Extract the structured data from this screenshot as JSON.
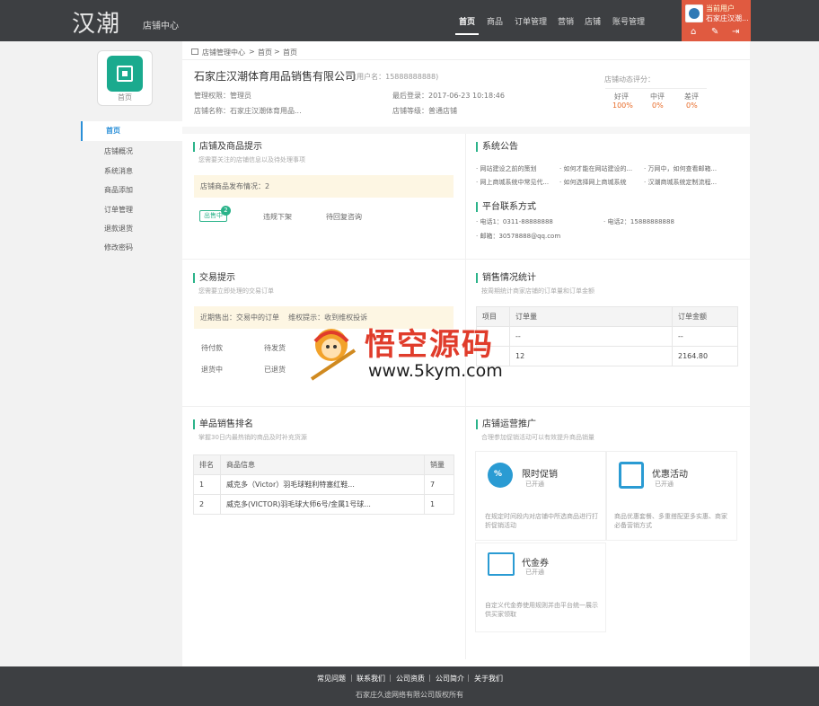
{
  "header": {
    "logo": "汉潮",
    "subtitle": "店铺中心",
    "nav": [
      "首页",
      "商品",
      "订单管理",
      "营销",
      "店铺",
      "账号管理"
    ],
    "user_label": "当前用户",
    "user_name": "石家庄汉潮..."
  },
  "sidebar": {
    "shop_label": "首页",
    "items": [
      "首页",
      "店铺概况",
      "系统消息",
      "商品添加",
      "订单管理",
      "退款退货",
      "修改密码"
    ]
  },
  "breadcrumb": [
    "店铺管理中心",
    ">",
    "首页",
    ">",
    "首页"
  ],
  "profile": {
    "company": "石家庄汉潮体育用品销售有限公司",
    "username": "(用户名：15888888888)",
    "role": "管理权限：管理员",
    "last_login": "最后登录：2017-06-23 10:18:46",
    "shop_name": "店铺名称：石家庄汉潮体育用品...",
    "shop_level": "店铺等级：普通店铺",
    "rating_title": "店铺动态评分：",
    "ratings": [
      {
        "label": "好评",
        "value": "100%"
      },
      {
        "label": "中评",
        "value": "0%"
      },
      {
        "label": "差评",
        "value": "0%"
      }
    ]
  },
  "shop_goods": {
    "title": "店铺及商品提示",
    "subtitle": "您需要关注的店铺信息以及待处理事项",
    "notice": "店铺商品发布情况：2",
    "on_sale": "出售中",
    "on_sale_count": "2",
    "violation": "违规下架",
    "pending_reply": "待回复咨询"
  },
  "announcements": {
    "title": "系统公告",
    "items": [
      "网站建设之前的策划",
      "如何才能在网站建设的...",
      "万网中，如何查看邮箱...",
      "网上商城系统中常见代...",
      "如何选择网上商城系统",
      "汉潮商城系统定制流程..."
    ]
  },
  "contact": {
    "title": "平台联系方式",
    "phone1": "电话1：0311-88888888",
    "phone2": "电话2：15888888888",
    "email": "邮箱：30578888@qq.com"
  },
  "trade": {
    "title": "交易提示",
    "subtitle": "您需要立即处理的交易订单",
    "notice1": "近期售出：交易中的订单",
    "notice2": "维权提示：收到维权投诉",
    "items": [
      "待付款",
      "待发货",
      "退货中",
      "已退货"
    ]
  },
  "sales_stats": {
    "title": "销售情况统计",
    "subtitle": "按周期统计商家店铺的订单量和订单金额",
    "headers": [
      "项目",
      "订单量",
      "订单金额"
    ],
    "rows": [
      [
        "",
        "--",
        "--"
      ],
      [
        "",
        "12",
        "2164.80"
      ]
    ]
  },
  "ranking": {
    "title": "单品销售排名",
    "subtitle": "掌握30日内最热销的商品及时补充货源",
    "headers": [
      "排名",
      "商品信息",
      "销量"
    ],
    "rows": [
      [
        "1",
        "威克多（Victor）羽毛球鞋利特塞红鞋...",
        "7"
      ],
      [
        "2",
        "威克多(VICTOR)羽毛球大师6号/金属1号球...",
        "1"
      ]
    ]
  },
  "promotion": {
    "title": "店铺运营推广",
    "subtitle": "合理参加促销活动可以有效提升商品销量",
    "items": [
      {
        "name": "限时促销",
        "status": "已开通",
        "desc": "在规定时间段内对店铺中所选商品进行打折促销活动"
      },
      {
        "name": "优惠活动",
        "status": "已开通",
        "desc": "商品优惠套餐、多重搭配更多实惠、商家必备营销方式"
      },
      {
        "name": "代金券",
        "status": "已开通",
        "desc": "自定义代金券使用规则并由平台统一展示供买家领取"
      }
    ]
  },
  "footer": {
    "links": [
      "常见问题",
      "联系我们",
      "公司资质",
      "公司简介",
      "关于我们"
    ],
    "copyright": "石家庄久途网络有限公司版权所有"
  },
  "watermark": {
    "title": "悟空源码",
    "url": "www.5kym.com"
  },
  "colors": {
    "accent": "#2bb38a",
    "user_box": "#e05a40",
    "header": "#3d3f42",
    "link_blue": "#2a8fd8"
  }
}
